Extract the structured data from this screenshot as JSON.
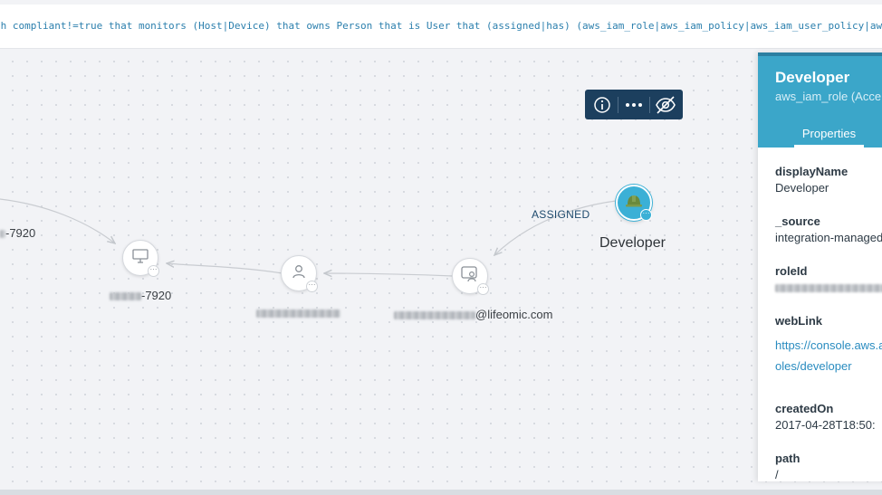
{
  "query": {
    "text": "ch compliant!=true that monitors (Host|Device) that owns Person that is User that (assigned|has) (aws_iam_role|aws_iam_policy|aws_iam_user_policy|aws_iam_group)"
  },
  "graph": {
    "nodes": {
      "host_offscreen": {
        "label_suffix": "-7920"
      },
      "device": {
        "label_suffix": "-7920",
        "icon": "monitor-icon"
      },
      "person": {
        "icon": "person-icon"
      },
      "user": {
        "label_suffix": "@lifeomic.com",
        "icon": "user-badge-icon"
      },
      "role": {
        "label": "Developer",
        "icon": "hard-hat-icon"
      }
    },
    "edges": {
      "assigned_label": "ASSIGNED"
    }
  },
  "toolbar": {
    "info_icon": "info-icon",
    "more_icon": "more-icon",
    "hide_icon": "eye-slash-icon"
  },
  "panel": {
    "title": "Developer",
    "subtitle": "aws_iam_role  (Acce",
    "tab": "Properties",
    "properties": {
      "displayName": {
        "key": "displayName",
        "value": "Developer"
      },
      "source": {
        "key": "_source",
        "value": "integration-managed"
      },
      "roleId": {
        "key": "roleId"
      },
      "webLink": {
        "key": "webLink",
        "line1": "https://console.aws.a",
        "line2": "oles/developer"
      },
      "createdOn": {
        "key": "createdOn",
        "value": "2017-04-28T18:50:"
      },
      "path": {
        "key": "path",
        "value": "/"
      }
    }
  },
  "colors": {
    "accent": "#3ba6c9",
    "toolbar": "#1c3f5e",
    "link": "#2a8cc0",
    "query": "#2b7fad"
  }
}
